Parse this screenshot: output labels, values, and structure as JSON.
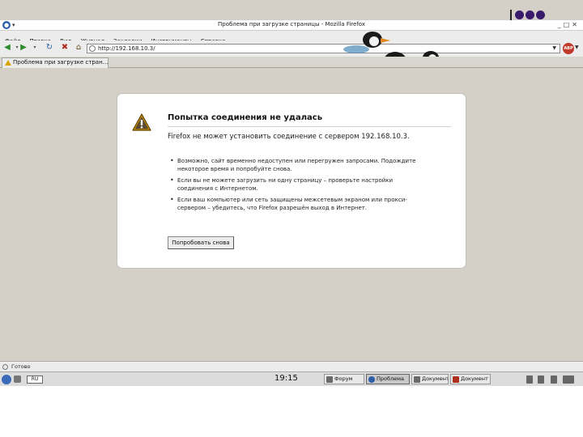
{
  "window": {
    "title": "Проблема при загрузке страницы - Mozilla Firefox"
  },
  "menu": [
    "Файл",
    "Правка",
    "Вид",
    "Журнал",
    "Закладки",
    "Инструменты",
    "Справка"
  ],
  "navigation": {
    "url": "http://192.168.10.3/",
    "search_engine_badge": "ABP"
  },
  "tab": {
    "label": "Проблема при загрузке стран..."
  },
  "error_page": {
    "title": "Попытка соединения не удалась",
    "message": "Firefox не может установить соединение с сервером 192.168.10.3.",
    "tips": [
      "Возможно, сайт временно недоступен или перегружен запросами. Подождите некоторое время и попробуйте снова.",
      "Если вы не можете загрузить ни одну страницу – проверьте настройки соединения с Интернетом.",
      "Если ваш компьютер или сеть защищены межсетевым экраном или прокси-сервером – убедитесь, что Firefox разрешён выход в Интернет."
    ],
    "retry_label": "Попробовать снова"
  },
  "statusbar": {
    "text": "Готово"
  },
  "taskbar": {
    "keyboard": "RU",
    "clock": "19:15",
    "tasks": [
      "Форум",
      "Проблема",
      "Документ",
      "Документ"
    ]
  },
  "colors": {
    "screen_bg": "#d4d0c8",
    "warning": "#d9a400"
  }
}
